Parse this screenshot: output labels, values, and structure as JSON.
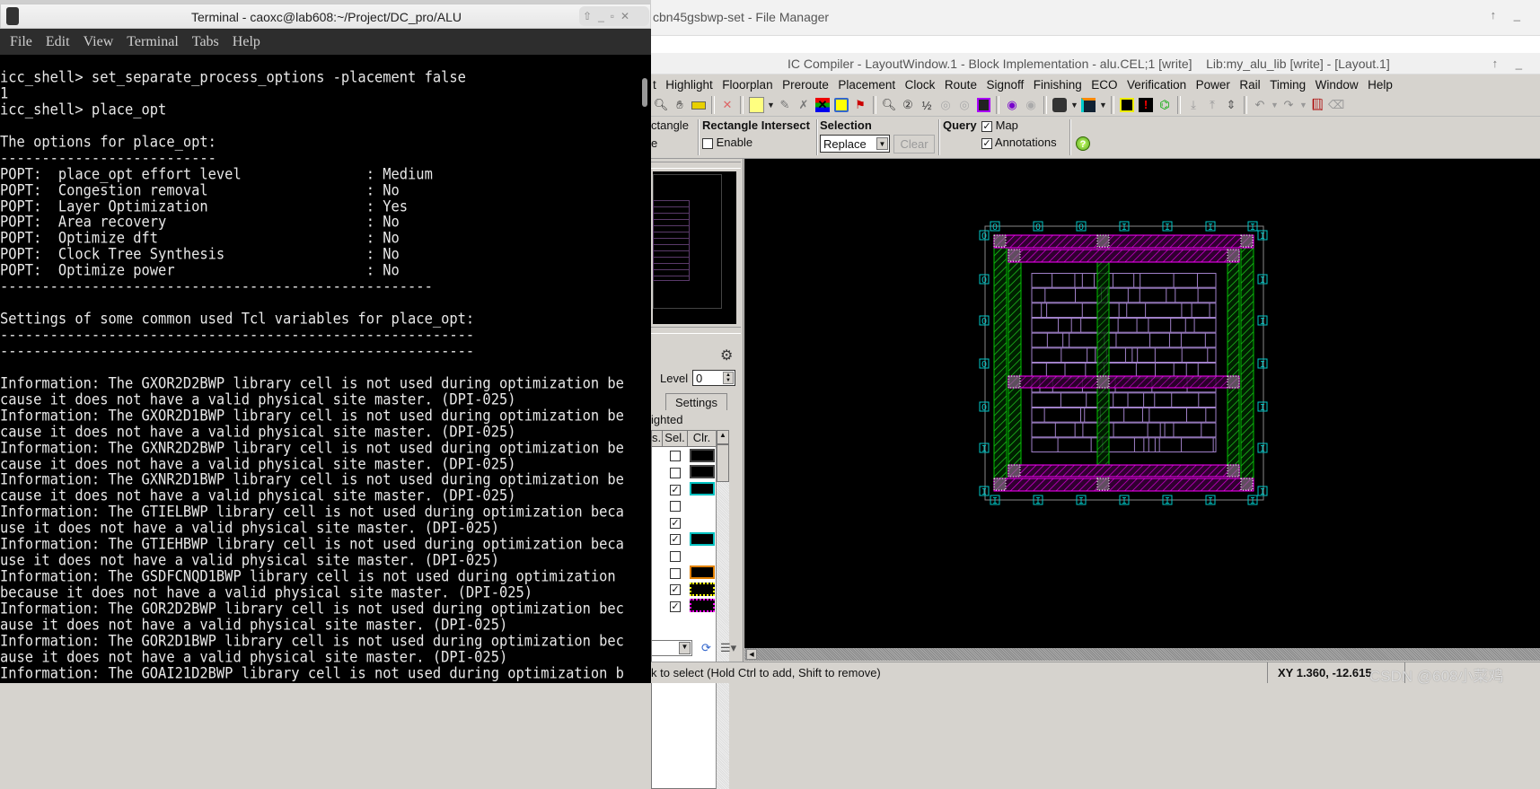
{
  "file_manager": {
    "title": "cbn45gsbwp-set - File Manager",
    "controls": "↑ _"
  },
  "icc": {
    "title": "IC Compiler - LayoutWindow.1 - Block Implementation - alu.CEL;1 [write]    Lib:my_alu_lib [write] - [Layout.1]",
    "controls": "↑ _",
    "menu": [
      "t",
      "Highlight",
      "Floorplan",
      "Preroute",
      "Placement",
      "Clock",
      "Route",
      "Signoff",
      "Finishing",
      "ECO",
      "Verification",
      "Power",
      "Rail",
      "Timing",
      "Window",
      "Help"
    ],
    "options": {
      "rectangle_partial": "ctangle",
      "rectangle_partial2": "e",
      "rect_intersect_label": "Rectangle Intersect",
      "enable_label": "Enable",
      "selection_label": "Selection",
      "selection_value": "Replace",
      "clear_label": "Clear",
      "query_label": "Query",
      "map_label": "Map",
      "annotations_label": "Annotations",
      "help_glyph": "?"
    },
    "panel": {
      "level_label": "Level",
      "level_value": "0",
      "settings_tab": "Settings",
      "highlighted_partial": "ighted",
      "col_vis": "s.",
      "col_sel": "Sel.",
      "col_clr": "Clr.",
      "rows": [
        {
          "sel": false,
          "color": "#444444",
          "style": "box"
        },
        {
          "sel": false,
          "color": "#444444",
          "style": "box"
        },
        {
          "sel": true,
          "color": "#00c0c0",
          "style": "box"
        },
        {
          "sel": false,
          "color": "",
          "style": "none"
        },
        {
          "sel": true,
          "color": "",
          "style": "none"
        },
        {
          "sel": true,
          "color": "#00c0c0",
          "style": "box"
        },
        {
          "sel": false,
          "color": "",
          "style": "none"
        },
        {
          "sel": false,
          "color": "#e08000",
          "style": "box"
        },
        {
          "sel": true,
          "color": "#ffff00",
          "style": "dots"
        },
        {
          "sel": true,
          "color": "#ff00ff",
          "style": "dots"
        }
      ]
    },
    "pins": {
      "top": [
        "O",
        "O",
        "O",
        "I",
        "I",
        "I",
        "I"
      ],
      "left": [
        "O",
        "O",
        "O",
        "O",
        "O",
        "I",
        "I"
      ],
      "right": [
        "I",
        "I",
        "I",
        "I",
        "I",
        "I",
        "I"
      ],
      "bottom": [
        "I",
        "I",
        "I",
        "I",
        "I",
        "I",
        "I"
      ]
    },
    "colors": {
      "power_ring": "#ff00ff",
      "strap": "#00e000",
      "cells": "#a080c8",
      "pins": "#00c8c8"
    },
    "status": "k to select (Hold Ctrl to add, Shift to remove)",
    "xy": "XY 1.360, -12.615"
  },
  "watermark": "CSDN @608小菜鸡",
  "terminal": {
    "title": "Terminal - caoxc@lab608:~/Project/DC_pro/ALU",
    "menu": [
      "File",
      "Edit",
      "View",
      "Terminal",
      "Tabs",
      "Help"
    ],
    "lines": [
      "icc_shell> set_separate_process_options -placement false",
      "1",
      "icc_shell> place_opt",
      "",
      "The options for place_opt:",
      "--------------------------",
      "POPT:  place_opt effort level               : Medium",
      "POPT:  Congestion removal                   : No",
      "POPT:  Layer Optimization                   : Yes",
      "POPT:  Area recovery                        : No",
      "POPT:  Optimize dft                         : No",
      "POPT:  Clock Tree Synthesis                 : No",
      "POPT:  Optimize power                       : No",
      "----------------------------------------------------",
      "",
      "Settings of some common used Tcl variables for place_opt:",
      "---------------------------------------------------------",
      "---------------------------------------------------------",
      "",
      "Information: The GXOR2D2BWP library cell is not used during optimization be",
      "cause it does not have a valid physical site master. (DPI-025)",
      "Information: The GXOR2D1BWP library cell is not used during optimization be",
      "cause it does not have a valid physical site master. (DPI-025)",
      "Information: The GXNR2D2BWP library cell is not used during optimization be",
      "cause it does not have a valid physical site master. (DPI-025)",
      "Information: The GXNR2D1BWP library cell is not used during optimization be",
      "cause it does not have a valid physical site master. (DPI-025)",
      "Information: The GTIELBWP library cell is not used during optimization beca",
      "use it does not have a valid physical site master. (DPI-025)",
      "Information: The GTIEHBWP library cell is not used during optimization beca",
      "use it does not have a valid physical site master. (DPI-025)",
      "Information: The GSDFCNQD1BWP library cell is not used during optimization ",
      "because it does not have a valid physical site master. (DPI-025)",
      "Information: The GOR2D2BWP library cell is not used during optimization bec",
      "ause it does not have a valid physical site master. (DPI-025)",
      "Information: The GOR2D1BWP library cell is not used during optimization bec",
      "ause it does not have a valid physical site master. (DPI-025)",
      "Information: The GOAI21D2BWP library cell is not used during optimization b"
    ]
  }
}
